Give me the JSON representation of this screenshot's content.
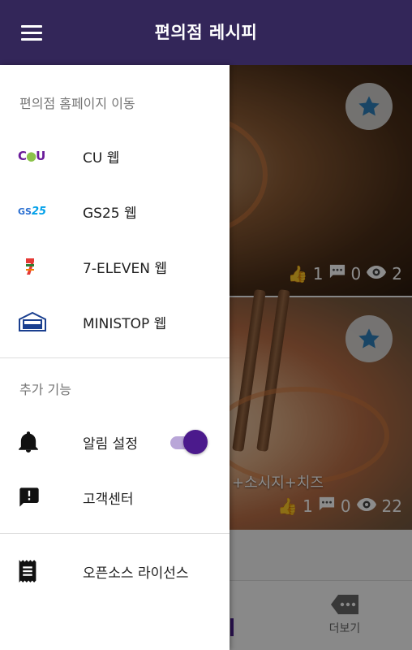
{
  "appbar": {
    "title": "편의점 레시피"
  },
  "cards": [
    {
      "likes": "1",
      "comments": "0",
      "views": "2"
    },
    {
      "likes": "1",
      "comments": "0",
      "views": "22",
      "caption": "+소시지+치즈"
    }
  ],
  "bottom_nav": {
    "more_label": "더보기"
  },
  "drawer": {
    "section1_label": "편의점 홈페이지 이동",
    "links": [
      {
        "label": "CU 웹",
        "icon": "cu-logo-icon"
      },
      {
        "label": "GS25 웹",
        "icon": "gs25-logo-icon"
      },
      {
        "label": "7-ELEVEN 웹",
        "icon": "seven-eleven-logo-icon"
      },
      {
        "label": "MINISTOP 웹",
        "icon": "ministop-logo-icon"
      }
    ],
    "section2_label": "추가 기능",
    "notification_label": "알림 설정",
    "notification_on": true,
    "support_label": "고객센터",
    "license_label": "오픈소스 라이선스"
  },
  "logos": {
    "cu": "CU",
    "gs25": "GS25",
    "seven": "7",
    "seven_sub": "ELEVEN",
    "ministop_top": "MINI",
    "ministop_bottom": "STOP"
  },
  "colors": {
    "appbar": "#332659",
    "accent": "#4b1a8c",
    "fav_star": "#2e7fb8"
  }
}
